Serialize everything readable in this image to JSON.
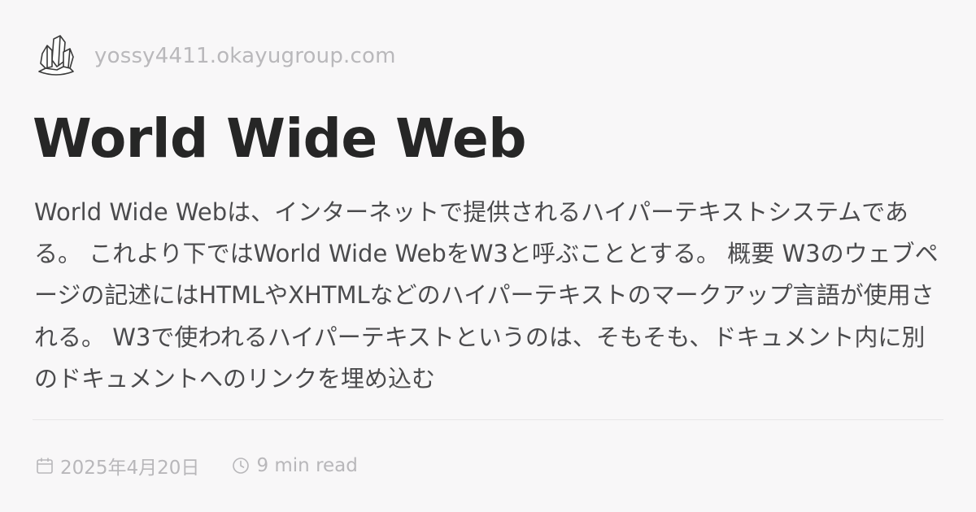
{
  "site": {
    "logo_icon": "crystal-logo-icon",
    "domain": "yossy4411.okayugroup.com"
  },
  "article": {
    "title": "World Wide Web",
    "excerpt": "World Wide Webは、インターネットで提供されるハイパーテキストシステムである。 これより下ではWorld Wide WebをW3と呼ぶこととする。 概要 W3のウェブページの記述にはHTMLやXHTMLなどのハイパーテキストのマークアップ言語が使用される。 W3で使われるハイパーテキストというのは、そもそも、ドキュメント内に別のドキュメントへのリンクを埋め込む",
    "date": "2025年4月20日",
    "date_icon": "calendar-icon",
    "read_time": "9 min read",
    "read_time_icon": "clock-icon"
  },
  "colors": {
    "background": "#f8f7f8",
    "title": "#262626",
    "body": "#4b4b4d",
    "muted": "#b8b7ba"
  }
}
